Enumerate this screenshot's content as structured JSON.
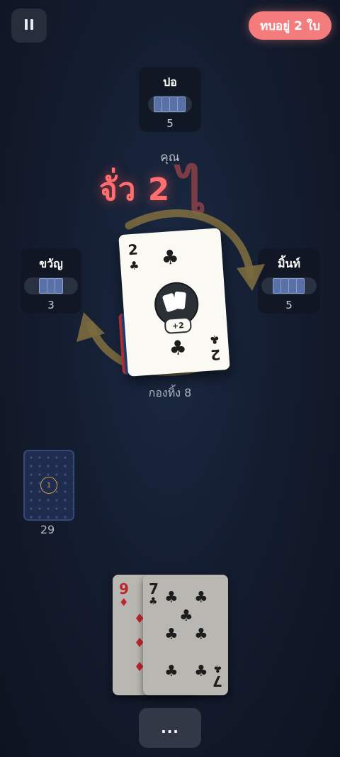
{
  "pause": {
    "icon": "pause-icon"
  },
  "status_badge": "ทบอยู่ 2 ใบ",
  "players": {
    "top": {
      "name": "ปอ",
      "count": "5"
    },
    "left": {
      "name": "ขวัญ",
      "count": "3"
    },
    "right": {
      "name": "มิ้นท์",
      "count": "5"
    }
  },
  "turn_label": "คุณ",
  "action_text": "จั่ว 2",
  "hook_glyph": "ไ",
  "top_card": {
    "rank": "2",
    "suit": "♣",
    "badge": "+2",
    "suit_color": "#1d1d1d"
  },
  "discard_label": "กองทิ้ง 8",
  "deck": {
    "marker": "1",
    "count": "29"
  },
  "hand": [
    {
      "rank": "9",
      "suit": "♦",
      "color": "#c0242f"
    },
    {
      "rank": "7",
      "suit": "♣",
      "color": "#1d1d1d"
    }
  ],
  "more_button": "...",
  "colors": {
    "accent_badge": "#f47c7c",
    "action_text": "#ff6f6f",
    "arrow": "#7a6a3e"
  }
}
